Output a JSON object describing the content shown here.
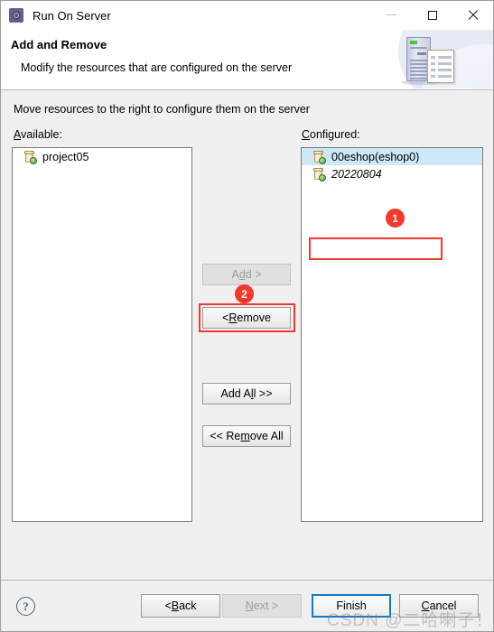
{
  "window": {
    "title": "Run On Server",
    "icon": "server-gear-icon",
    "controls": {
      "minimize": "minimize-icon",
      "maximize": "maximize-icon",
      "close": "close-icon"
    }
  },
  "header": {
    "title": "Add and Remove",
    "description": "Modify the resources that are configured on the server",
    "art": "server-and-document-illustration"
  },
  "content": {
    "instruction": "Move resources to the right to configure them on the server",
    "available": {
      "label_accel": "A",
      "label_rest": "vailable:",
      "items": [
        {
          "name": "project05",
          "icon": "module-jar-icon",
          "selected": false,
          "italic": false
        }
      ]
    },
    "configured": {
      "label_accel": "C",
      "label_rest": "onfigured:",
      "items": [
        {
          "name": "00eshop(eshop0)",
          "icon": "module-jar-icon",
          "selected": true,
          "italic": false
        },
        {
          "name": "20220804",
          "icon": "module-jar-icon",
          "selected": false,
          "italic": true
        }
      ]
    },
    "buttons": [
      {
        "id": "add",
        "pre": "A",
        "accel": "d",
        "post": "d >",
        "enabled": false
      },
      {
        "id": "remove",
        "pre": "< ",
        "accel": "R",
        "post": "emove",
        "enabled": true
      },
      {
        "id": "add-all",
        "pre": "Add A",
        "accel": "l",
        "post": "l >>",
        "enabled": true
      },
      {
        "id": "remove-all",
        "pre": "<< Re",
        "accel": "m",
        "post": "ove All",
        "enabled": true
      }
    ]
  },
  "annotations": [
    {
      "id": "1",
      "label": "1",
      "target": "configured-selected-item",
      "color": "#f2392c"
    },
    {
      "id": "2",
      "label": "2",
      "target": "remove-button",
      "color": "#f2392c"
    }
  ],
  "footer": {
    "help": "?",
    "buttons": [
      {
        "id": "back",
        "pre": "< ",
        "accel": "B",
        "post": "ack",
        "enabled": true,
        "default": false
      },
      {
        "id": "next",
        "pre": "",
        "accel": "N",
        "post": "ext >",
        "enabled": false,
        "default": false
      },
      {
        "id": "finish",
        "pre": "",
        "accel": "",
        "post": "Finish",
        "enabled": true,
        "default": true
      },
      {
        "id": "cancel",
        "pre": "",
        "accel": "C",
        "post": "ancel",
        "enabled": true,
        "default": false
      }
    ]
  },
  "watermark": "CSDN @二哈喇子！"
}
